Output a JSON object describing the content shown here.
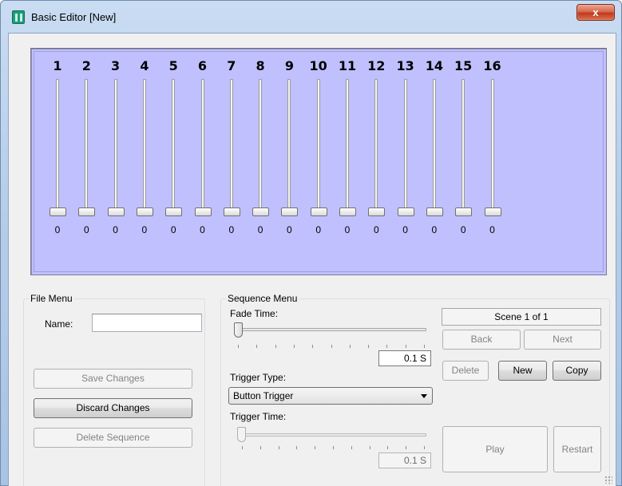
{
  "window": {
    "title": "Basic Editor [New]",
    "close_glyph": "x"
  },
  "channels": [
    {
      "label": "1",
      "value": "0"
    },
    {
      "label": "2",
      "value": "0"
    },
    {
      "label": "3",
      "value": "0"
    },
    {
      "label": "4",
      "value": "0"
    },
    {
      "label": "5",
      "value": "0"
    },
    {
      "label": "6",
      "value": "0"
    },
    {
      "label": "7",
      "value": "0"
    },
    {
      "label": "8",
      "value": "0"
    },
    {
      "label": "9",
      "value": "0"
    },
    {
      "label": "10",
      "value": "0"
    },
    {
      "label": "11",
      "value": "0"
    },
    {
      "label": "12",
      "value": "0"
    },
    {
      "label": "13",
      "value": "0"
    },
    {
      "label": "14",
      "value": "0"
    },
    {
      "label": "15",
      "value": "0"
    },
    {
      "label": "16",
      "value": "0"
    }
  ],
  "file_menu": {
    "title": "File Menu",
    "name_label": "Name:",
    "name_value": "",
    "save_label": "Save Changes",
    "discard_label": "Discard Changes",
    "delete_label": "Delete Sequence"
  },
  "sequence_menu": {
    "title": "Sequence Menu",
    "fade_label": "Fade Time:",
    "fade_value": "0.1 S",
    "trigger_type_label": "Trigger Type:",
    "trigger_type_value": "Button Trigger",
    "trigger_time_label": "Trigger Time:",
    "trigger_time_value": "0.1 S",
    "scene_text": "Scene 1 of 1",
    "back_label": "Back",
    "next_label": "Next",
    "delete_label": "Delete",
    "new_label": "New",
    "copy_label": "Copy",
    "play_label": "Play",
    "restart_label": "Restart"
  },
  "colors": {
    "channel_panel_bg": "#c0c0ff"
  }
}
